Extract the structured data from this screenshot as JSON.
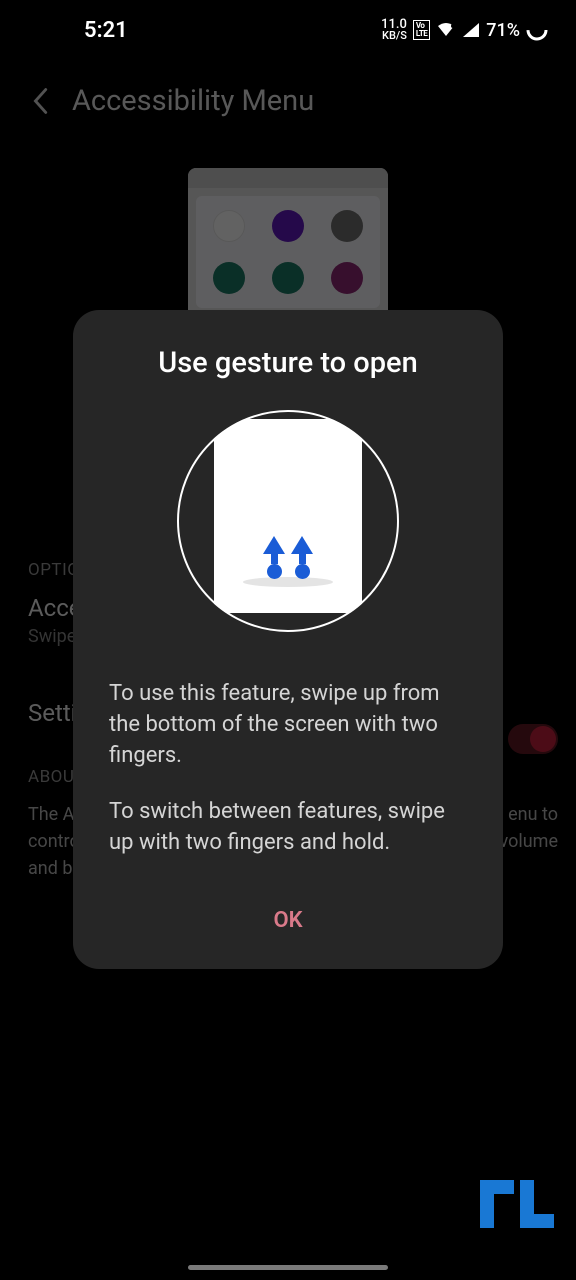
{
  "status": {
    "time": "5:21",
    "kbs_top": "11.0",
    "kbs_bottom": "KB/S",
    "lte": "Vo\nLTE",
    "battery": "71%"
  },
  "header": {
    "title": "Accessibility Menu"
  },
  "background": {
    "options_label": "OPTIO",
    "access_title": "Acce",
    "access_sub": "Swipe",
    "settings_title": "Settin",
    "about_label": "ABOUT",
    "about_line1": "The Ac",
    "about_line2": "contro",
    "about_line3": "and br",
    "about_right1": "enu to",
    "about_right2": "volume"
  },
  "dialog": {
    "title": "Use gesture to open",
    "body1": "To use this feature, swipe up from the bottom of the screen with two fingers.",
    "body2": "To switch between features, swipe up with two fingers and hold.",
    "ok_label": "OK"
  }
}
